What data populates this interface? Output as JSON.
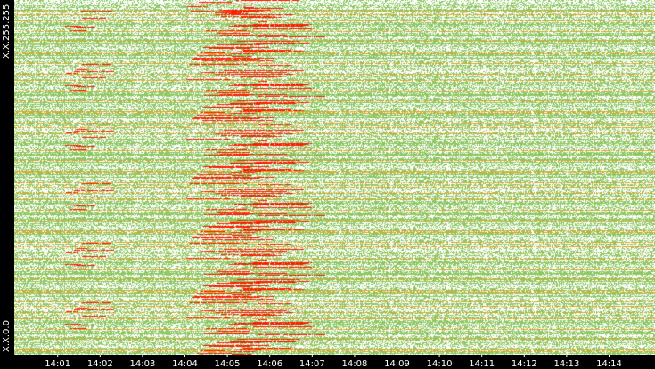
{
  "chart_data": {
    "type": "heatmap",
    "title": "",
    "xlabel": "",
    "ylabel": "",
    "y_tick_labels": [
      "X.X.255.255",
      "X.X.0.0"
    ],
    "x_tick_labels": [
      "14:01",
      "14:02",
      "14:03",
      "14:04",
      "14:05",
      "14:06",
      "14:07",
      "14:08",
      "14:09",
      "14:10",
      "14:11",
      "14:12",
      "14:13",
      "14:14"
    ],
    "x_range_minutes": [
      "14:00",
      "14:15"
    ],
    "grid": false,
    "colors": {
      "background": "#ffffff",
      "low_activity": "#8dc763",
      "medium_activity": "#e8a020",
      "high_activity": "#ff1a00",
      "frame": "#000000",
      "text": "#ffffff"
    },
    "high_activity_bursts": [
      {
        "start": "14:01",
        "end": "14:02",
        "description_rows": "scattered"
      },
      {
        "start": "14:04",
        "end": "14:07",
        "description_rows": "widespread"
      }
    ]
  }
}
